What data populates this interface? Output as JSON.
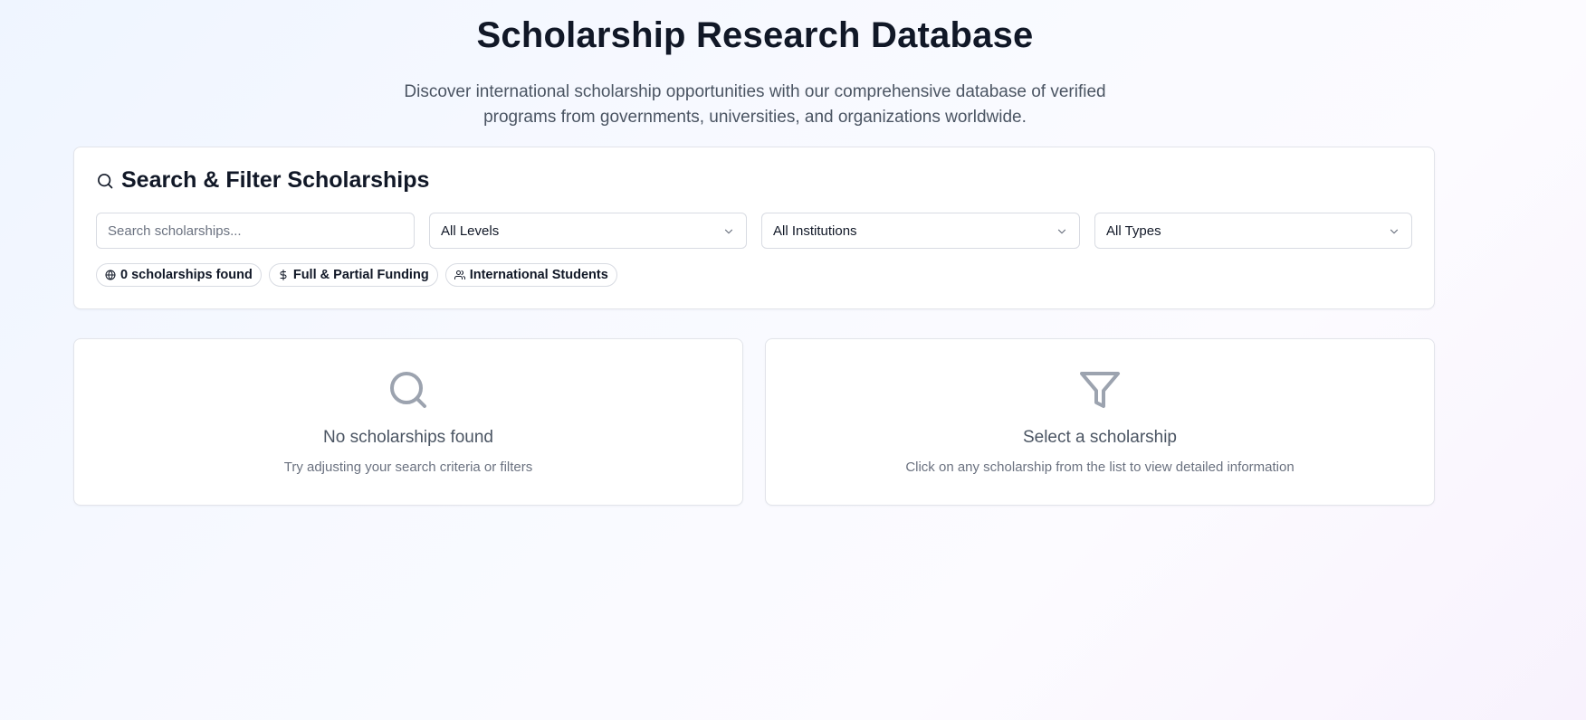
{
  "header": {
    "title": "Scholarship Research Database",
    "subtitle": "Discover international scholarship opportunities with our comprehensive database of verified programs from governments, universities, and organizations worldwide."
  },
  "filters": {
    "heading": "Search & Filter Scholarships",
    "search_placeholder": "Search scholarships...",
    "level_select": "All Levels",
    "institution_select": "All Institutions",
    "type_select": "All Types"
  },
  "badges": [
    {
      "icon": "globe-icon",
      "label": "0 scholarships found"
    },
    {
      "icon": "dollar-icon",
      "label": "Full & Partial Funding"
    },
    {
      "icon": "users-icon",
      "label": "International Students"
    }
  ],
  "results_panel": {
    "icon": "search-icon",
    "title": "No scholarships found",
    "description": "Try adjusting your search criteria or filters"
  },
  "detail_panel": {
    "icon": "filter-icon",
    "title": "Select a scholarship",
    "description": "Click on any scholarship from the list to view detailed information"
  },
  "colors": {
    "heading_text": "#111827",
    "muted_text": "#4b5563",
    "icon_gray": "#9ca3af",
    "border": "#e2e4ea"
  }
}
